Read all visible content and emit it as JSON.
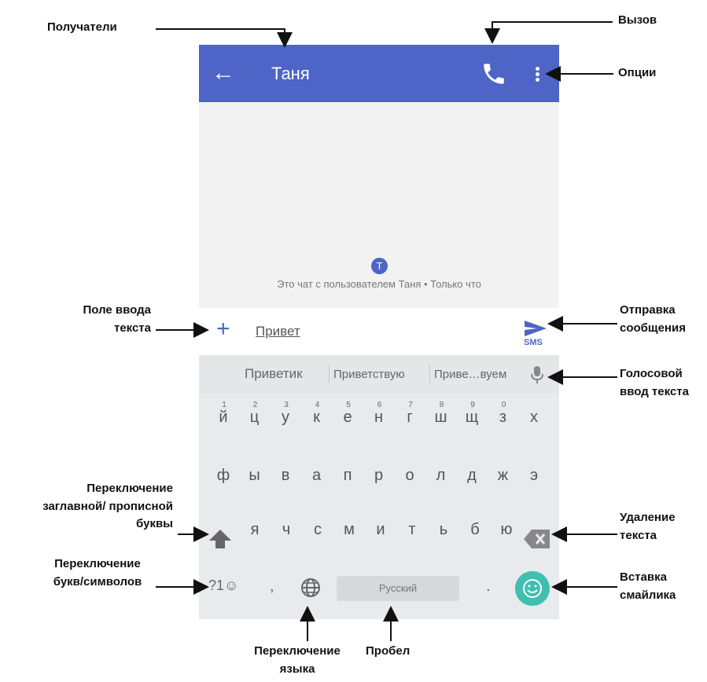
{
  "app": {
    "contact_name": "Таня",
    "chat_info": "Это чат с пользователем Таня • Только что",
    "avatar_letter": "T",
    "message_text": "Привет",
    "send_type": "SMS",
    "accent_color": "#4e64c6",
    "emoji_color": "#3fbfb0"
  },
  "keyboard": {
    "suggestions": [
      "Приветик",
      "Приветствую",
      "Приве…вуем"
    ],
    "row1_numbers": [
      "1",
      "2",
      "3",
      "4",
      "5",
      "6",
      "7",
      "8",
      "9",
      "0"
    ],
    "row1": [
      "й",
      "ц",
      "у",
      "к",
      "е",
      "н",
      "г",
      "ш",
      "щ",
      "з",
      "х"
    ],
    "row2": [
      "ф",
      "ы",
      "в",
      "а",
      "п",
      "р",
      "о",
      "л",
      "д",
      "ж",
      "э"
    ],
    "row3": [
      "я",
      "ч",
      "с",
      "м",
      "и",
      "т",
      "ь",
      "б",
      "ю"
    ],
    "symbols_key": "?1☺",
    "comma": ",",
    "space_label": "Русский",
    "period": "."
  },
  "annotations": {
    "recipients": "Получатели",
    "call": "Вызов",
    "options": "Опции",
    "input_field": [
      "Поле ввода",
      "текста"
    ],
    "send_message": [
      "Отправка",
      "сообщения"
    ],
    "voice_input": [
      "Голосовой",
      "ввод текста"
    ],
    "case_switch": [
      "Переключение",
      "заглавной/ прописной",
      "буквы"
    ],
    "delete_text": [
      "Удаление",
      "текста"
    ],
    "symbols_switch": [
      "Переключение",
      "букв/символов"
    ],
    "insert_emoji": [
      "Вставка",
      "смайлика"
    ],
    "language_switch": [
      "Переключение",
      "языка"
    ],
    "space": "Пробел"
  }
}
